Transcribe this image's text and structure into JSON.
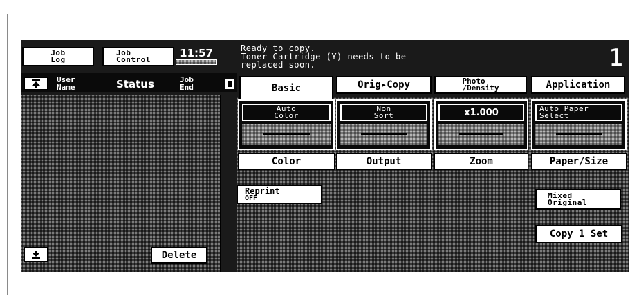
{
  "header": {
    "job_log": "Job\nLog",
    "job_control": "Job\nControl",
    "clock": "11:57",
    "message": "Ready to copy.\nToner Cartridge (Y) needs to be\nreplaced soon.",
    "copy_count": "1"
  },
  "job_list": {
    "col_user": "User\nName",
    "col_status": "Status",
    "col_end": "Job\nEnd",
    "delete": "Delete"
  },
  "tabs": [
    "Basic",
    "Orig▸Copy",
    "Photo\n/Density",
    "Application"
  ],
  "settings": [
    {
      "value": "Auto\nColor",
      "label": "Color"
    },
    {
      "value": "Non\nSort",
      "label": "Output"
    },
    {
      "value": "x1.000",
      "label": "Zoom"
    },
    {
      "value": "Auto Paper\nSelect",
      "label": "Paper/Size"
    }
  ],
  "buttons": {
    "reprint": "Reprint",
    "reprint_state": "OFF",
    "mixed_original": "Mixed\nOriginal",
    "copy_1_set": "Copy 1 Set"
  },
  "icons": [
    "scroll-top-icon",
    "scroll-bottom-icon",
    "job-end-icon"
  ]
}
